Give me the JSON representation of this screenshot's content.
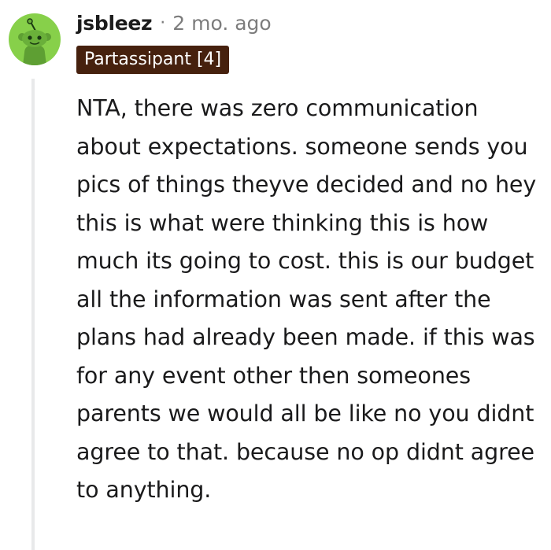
{
  "comment": {
    "avatar_icon": "reddit-snoo-avatar-icon",
    "avatar_color": "#87d04a",
    "username": "jsbleez",
    "separator": "·",
    "timestamp": "2 mo. ago",
    "flair": "Partassipant [4]",
    "flair_color": "#46210e",
    "body": "NTA, there was zero communication about expectations. someone sends you pics of things theyve decided and no hey this is what were thinking this is how much its going to cost. this is our budget all the information was sent after the plans had already been made. if this was for any event other then someones parents we would all be like no you didnt agree to that. because no op didnt agree to anything."
  }
}
